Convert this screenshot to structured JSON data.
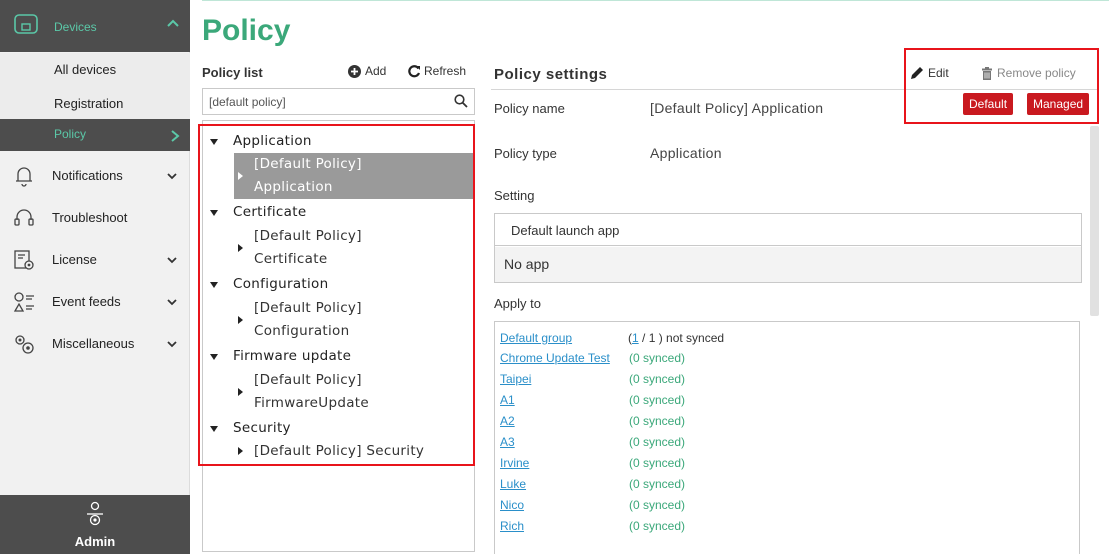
{
  "sidebar": {
    "devices_label": "Devices",
    "sub_items": [
      {
        "label": "All devices"
      },
      {
        "label": "Registration"
      },
      {
        "label": "Policy"
      }
    ],
    "items": [
      {
        "label": "Notifications",
        "icon": "bell-icon"
      },
      {
        "label": "Troubleshoot",
        "icon": "headset-icon"
      },
      {
        "label": "License",
        "icon": "license-icon"
      },
      {
        "label": "Event feeds",
        "icon": "event-feeds-icon"
      },
      {
        "label": "Miscellaneous",
        "icon": "gears-icon"
      }
    ],
    "admin_label": "Admin"
  },
  "page_title": "Policy",
  "policy_list": {
    "title": "Policy list",
    "add_label": "Add",
    "refresh_label": "Refresh",
    "search_value": "[default policy]",
    "groups": [
      {
        "name": "Application",
        "items": [
          {
            "line1": "[Default Policy]",
            "line2": "Application"
          }
        ]
      },
      {
        "name": "Certificate",
        "items": [
          {
            "line1": "[Default Policy]",
            "line2": "Certificate"
          }
        ]
      },
      {
        "name": "Configuration",
        "items": [
          {
            "line1": "[Default Policy]",
            "line2": "Configuration"
          }
        ]
      },
      {
        "name": "Firmware update",
        "items": [
          {
            "line1": "[Default Policy]",
            "line2": "FirmwareUpdate"
          }
        ]
      },
      {
        "name": "Security",
        "items": [
          {
            "line1": "[Default Policy] Security",
            "line2": ""
          }
        ]
      }
    ]
  },
  "policy_settings": {
    "title": "Policy settings",
    "edit_label": "Edit",
    "remove_label": "Remove policy",
    "badges": [
      "Default",
      "Managed"
    ],
    "policy_name_label": "Policy name",
    "policy_name_value": "[Default Policy] Application",
    "policy_type_label": "Policy type",
    "policy_type_value": "Application",
    "setting_label": "Setting",
    "setting_header": "Default launch app",
    "setting_value": "No app",
    "apply_to_label": "Apply to",
    "apply_to": [
      {
        "name": "Default group",
        "sync_prefix": "(",
        "sync_link": "1",
        "sync_suffix": " / 1 ) not synced"
      },
      {
        "name": "Chrome Update Test",
        "sync": "(0 synced)"
      },
      {
        "name": "Taipei",
        "sync": "(0 synced)"
      },
      {
        "name": "A1",
        "sync": "(0 synced)"
      },
      {
        "name": "A2",
        "sync": "(0 synced)"
      },
      {
        "name": "A3",
        "sync": "(0 synced)"
      },
      {
        "name": "Irvine",
        "sync": "(0 synced)"
      },
      {
        "name": "Luke",
        "sync": "(0 synced)"
      },
      {
        "name": "Nico",
        "sync": "(0 synced)"
      },
      {
        "name": "Rich",
        "sync": "(0 synced)"
      }
    ]
  },
  "colors": {
    "brand_green": "#3ba87a",
    "sidebar_dark": "#4d4d4d",
    "badge_red": "#c9191f",
    "link_blue": "#2a8fc9",
    "highlight_red": "#e8141b"
  }
}
